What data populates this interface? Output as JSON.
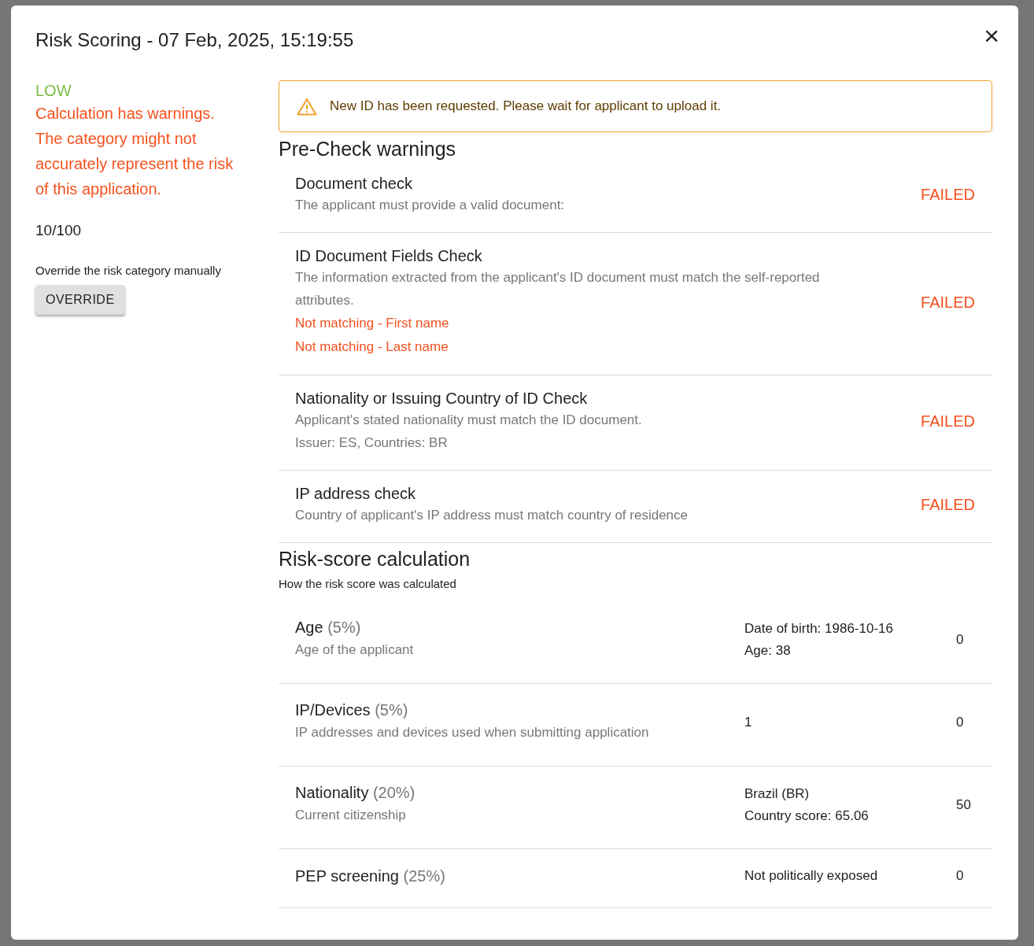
{
  "dialog": {
    "title": "Risk Scoring - 07 Feb, 2025, 15:19:55",
    "close": "×"
  },
  "summary": {
    "category": "LOW",
    "warning": "Calculation has warnings. The category might not accurately represent the risk of this application.",
    "score": "10/100",
    "override_hint": "Override the risk category manually",
    "override_button": "OVERRIDE"
  },
  "alert": {
    "text": "New ID has been requested. Please wait for applicant to upload it."
  },
  "prechecks": {
    "heading": "Pre-Check warnings",
    "items": [
      {
        "title": "Document check",
        "lines": [
          "The applicant must provide a valid document:"
        ],
        "status": "FAILED"
      },
      {
        "title": "ID Document Fields Check",
        "lines": [
          "The information extracted from the applicant's ID document must match the self-reported attributes."
        ],
        "issues": [
          "Not matching - First name",
          "Not matching - Last name"
        ],
        "status": "FAILED"
      },
      {
        "title": "Nationality or Issuing Country of ID Check",
        "lines": [
          "Applicant's stated nationality must match the ID document.",
          "Issuer: ES, Countries: BR"
        ],
        "status": "FAILED"
      },
      {
        "title": "IP address check",
        "lines": [
          "Country of applicant's IP address must match country of residence"
        ],
        "status": "FAILED"
      }
    ]
  },
  "calculation": {
    "heading": "Risk-score calculation",
    "subheading": "How the risk score was calculated",
    "factors": [
      {
        "name": "Age",
        "weight": "(5%)",
        "description": "Age of the applicant",
        "details": [
          "Date of birth: 1986-10-16",
          "Age: 38"
        ],
        "score": "0"
      },
      {
        "name": "IP/Devices",
        "weight": "(5%)",
        "description": "IP addresses and devices used when submitting application",
        "details": [
          "1"
        ],
        "score": "0"
      },
      {
        "name": "Nationality",
        "weight": "(20%)",
        "description": "Current citizenship",
        "details": [
          "Brazil (BR)",
          "Country score: 65.06"
        ],
        "score": "50"
      },
      {
        "name": "PEP screening",
        "weight": "(25%)",
        "details": [
          "Not politically exposed"
        ],
        "score": "0"
      }
    ]
  }
}
